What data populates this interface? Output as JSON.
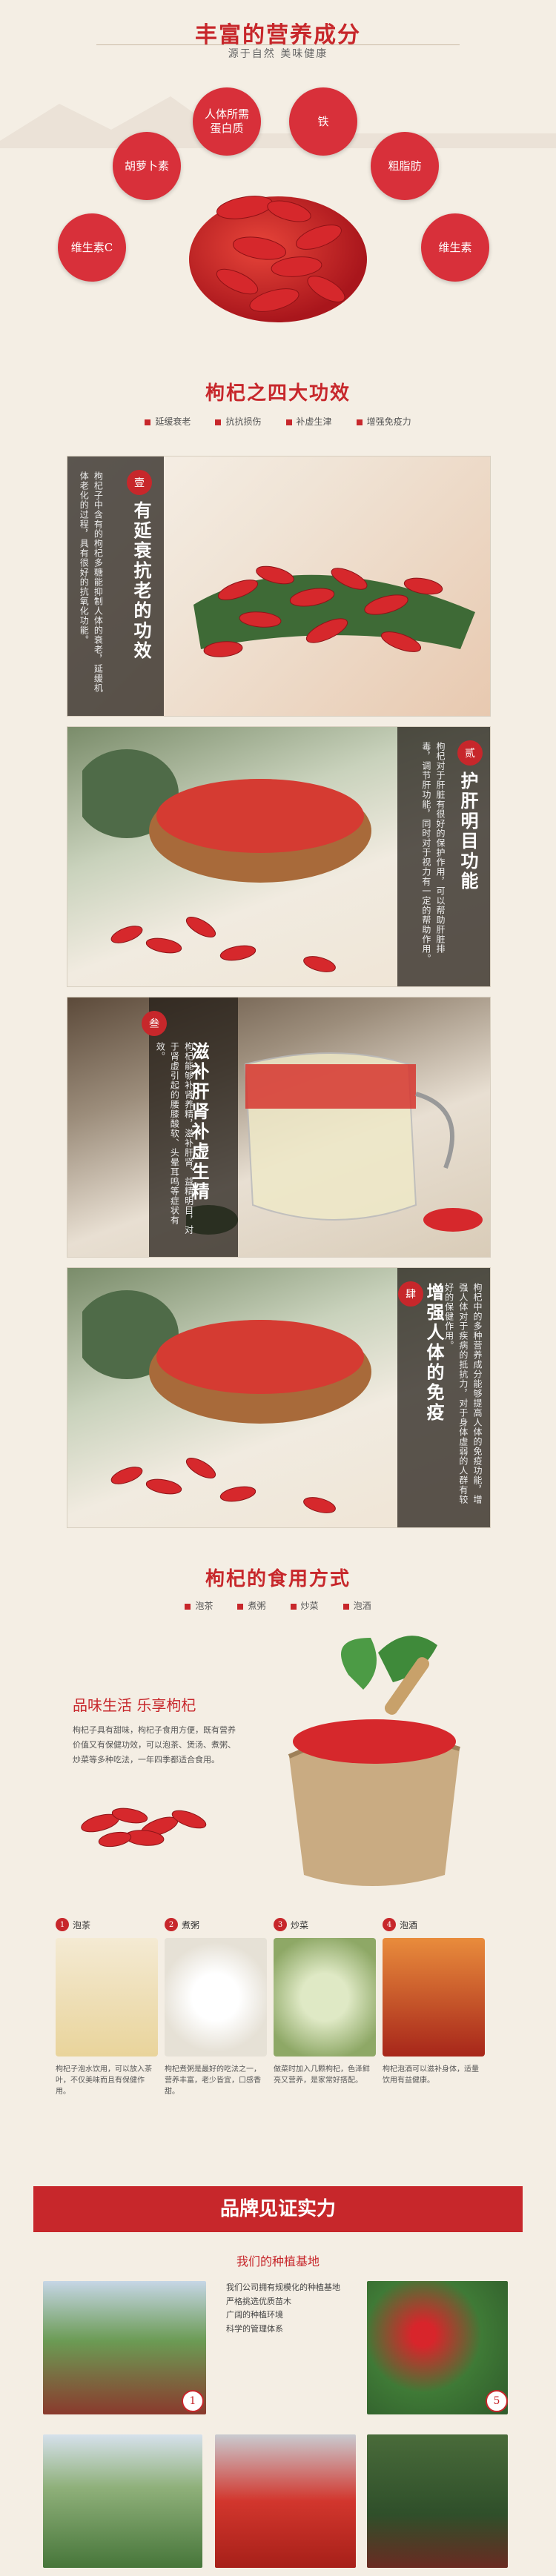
{
  "nutrition": {
    "title": "丰富的营养成分",
    "subtitle": "源于自然 美味健康",
    "nutrients": [
      "胡萝卜素",
      "人体所需\n蛋白质",
      "铁",
      "粗脂肪",
      "维生素C",
      "维生素"
    ]
  },
  "effects": {
    "title": "枸杞之四大功效",
    "tags": [
      "延缓衰老",
      "抗抗损伤",
      "补虚生津",
      "增强免疫力"
    ],
    "items": [
      {
        "num": "壹",
        "title": "有延衰抗老的功效",
        "body": "枸杞子中含有的枸杞多糖能抑制人体的衰老，延缓机体老化的过程，具有很好的抗氧化功能。"
      },
      {
        "num": "贰",
        "title": "护肝明目功能",
        "body": "枸杞对于肝脏有很好的保护作用，可以帮助肝脏排毒，调节肝功能，同时对于视力有一定的帮助作用。"
      },
      {
        "num": "叁",
        "title": "滋补肝肾补虚生精",
        "body": "枸杞能够补肾养精，滋补肝肾、益精明目，对于肾虚引起的腰膝酸软、头晕耳鸣等症状有效。"
      },
      {
        "num": "肆",
        "title": "增强人体的免疫",
        "body": "枸杞中的多种营养成分能够提高人体的免疫功能，增强人体对于疾病的抵抗力，对于身体虚弱的人群有较好的保健作用。"
      }
    ]
  },
  "usage": {
    "title": "枸杞的食用方式",
    "tags": [
      "泡茶",
      "煮粥",
      "炒菜",
      "泡酒"
    ],
    "slogan": "品味生活 乐享枸杞",
    "intro": "枸杞子具有甜味，枸杞子食用方便，既有营养价值又有保健功效，可以泡茶、煲汤、煮粥、炒菜等多种吃法，一年四季都适合食用。",
    "steps": [
      {
        "num": "1",
        "name": "泡茶",
        "desc": "枸杞子泡水饮用，可以放入茶叶，不仅美味而且有保健作用。"
      },
      {
        "num": "2",
        "name": "煮粥",
        "desc": "枸杞煮粥是最好的吃法之一，营养丰富，老少皆宜，口感香甜。"
      },
      {
        "num": "3",
        "name": "炒菜",
        "desc": "做菜时加入几颗枸杞，色泽鲜亮又营养，是家常好搭配。"
      },
      {
        "num": "4",
        "name": "泡酒",
        "desc": "枸杞泡酒可以滋补身体，适量饮用有益健康。"
      }
    ]
  },
  "brand": {
    "title": "品牌见证实力",
    "base_title": "我们的种植基地",
    "points": [
      "我们公司拥有规模化的种植基地",
      "严格挑选优质苗木",
      "广阔的种植环境",
      "科学的管理体系"
    ]
  }
}
